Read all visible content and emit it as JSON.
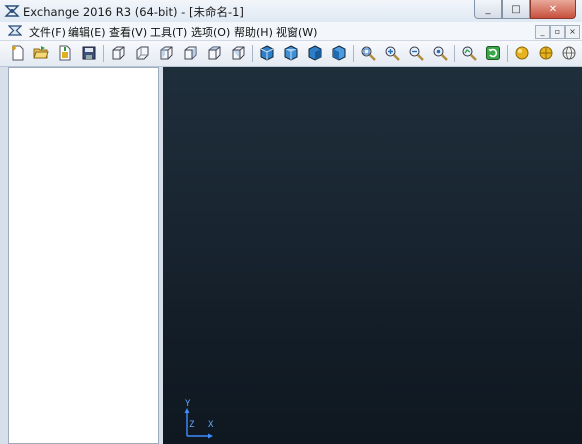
{
  "window": {
    "title": "Exchange 2016 R3 (64-bit) - [未命名-1]",
    "controls": {
      "minimize": "_",
      "maximize": "□",
      "close": "✕"
    }
  },
  "menubar": {
    "items": [
      "文件(F)",
      "编辑(E)",
      "查看(V)",
      "工具(T)",
      "选项(O)",
      "帮助(H)",
      "视窗(W)"
    ],
    "mdi_controls": [
      "_",
      "▫",
      "×"
    ]
  },
  "toolbar": {
    "buttons": [
      "new-file-icon",
      "open-folder-icon",
      "import-icon",
      "save-icon",
      "view-cube-front-icon",
      "view-cube-back-icon",
      "view-cube-left-icon",
      "view-cube-right-icon",
      "view-cube-top-icon",
      "view-cube-bottom-icon",
      "shaded-cube-1-icon",
      "shaded-cube-2-icon",
      "shaded-cube-3-icon",
      "shaded-cube-4-icon",
      "zoom-window-icon",
      "zoom-in-icon",
      "zoom-out-icon",
      "zoom-fit-icon",
      "inspect-icon",
      "refresh-icon",
      "sphere-light-icon",
      "sphere-shaded-icon",
      "sphere-wire-icon"
    ]
  },
  "viewport": {
    "axis_labels": {
      "y": "Y",
      "z": "Z",
      "x": "X"
    },
    "background": "#1a2733"
  }
}
